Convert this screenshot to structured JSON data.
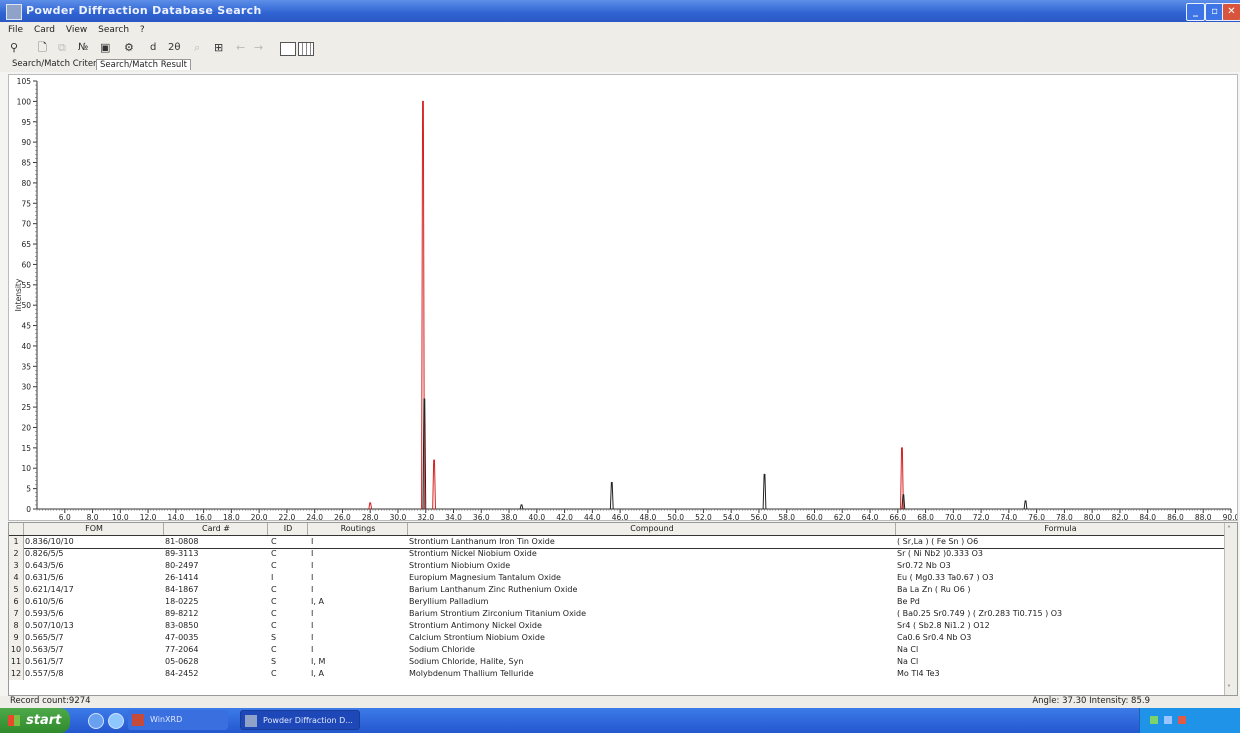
{
  "window": {
    "title": "Powder Diffraction Database Search"
  },
  "menu": [
    "File",
    "Card",
    "View",
    "Search",
    "?"
  ],
  "toolbar": {
    "no_label": "№",
    "d_label": "d",
    "two_theta_label": "2θ"
  },
  "tabs": [
    {
      "label": "Search/Match Criteria",
      "active": false
    },
    {
      "label": "Search/Match Result",
      "active": true
    }
  ],
  "chart_data": {
    "type": "line",
    "ylabel": "Intensity",
    "xlim": [
      4.0,
      90.0
    ],
    "ylim": [
      0,
      105
    ],
    "y_ticks": [
      "105",
      "100",
      "95",
      "90",
      "85",
      "80",
      "75",
      "70",
      "65",
      "60",
      "55",
      "50",
      "45",
      "40",
      "35",
      "30",
      "25",
      "20",
      "15",
      "10",
      "5",
      "0"
    ],
    "x_ticks": [
      "6.0",
      "8.0",
      "10.0",
      "12.0",
      "14.0",
      "16.0",
      "18.0",
      "20.0",
      "22.0",
      "24.0",
      "26.0",
      "28.0",
      "30.0",
      "32.0",
      "34.0",
      "36.0",
      "38.0",
      "40.0",
      "42.0",
      "44.0",
      "46.0",
      "48.0",
      "50.0",
      "52.0",
      "54.0",
      "56.0",
      "58.0",
      "60.0",
      "62.0",
      "64.0",
      "66.0",
      "68.0",
      "70.0",
      "72.0",
      "74.0",
      "76.0",
      "78.0",
      "80.0",
      "82.0",
      "84.0",
      "86.0",
      "88.0",
      "90.0"
    ],
    "series": [
      {
        "color": "#d62020",
        "peaks": [
          {
            "x": 28.0,
            "y": 1.5
          },
          {
            "x": 31.8,
            "y": 100
          },
          {
            "x": 32.6,
            "y": 12
          },
          {
            "x": 66.3,
            "y": 15
          }
        ]
      },
      {
        "color": "#222222",
        "peaks": [
          {
            "x": 31.9,
            "y": 27
          },
          {
            "x": 45.4,
            "y": 6.5
          },
          {
            "x": 56.4,
            "y": 8.5
          },
          {
            "x": 66.4,
            "y": 3.5
          },
          {
            "x": 75.2,
            "y": 2
          },
          {
            "x": 38.9,
            "y": 1
          }
        ]
      }
    ]
  },
  "table": {
    "columns": [
      "FOM",
      "Card #",
      "ID",
      "Routings",
      "Compound",
      "Formula"
    ],
    "rows": [
      {
        "n": "1",
        "fom": "0.836/10/10",
        "card": "81-0808",
        "id": "C",
        "rout": "I",
        "compound": "Strontium Lanthanum Iron Tin Oxide",
        "formula": "( Sr,La ) ( Fe Sn ) O6"
      },
      {
        "n": "2",
        "fom": "0.826/5/5",
        "card": "89-3113",
        "id": "C",
        "rout": "I",
        "compound": "Strontium Nickel Niobium Oxide",
        "formula": "Sr ( Ni Nb2 )0.333 O3"
      },
      {
        "n": "3",
        "fom": "0.643/5/6",
        "card": "80-2497",
        "id": "C",
        "rout": "I",
        "compound": "Strontium Niobium Oxide",
        "formula": "Sr0.72 Nb O3"
      },
      {
        "n": "4",
        "fom": "0.631/5/6",
        "card": "26-1414",
        "id": "I",
        "rout": "I",
        "compound": "Europium Magnesium Tantalum Oxide",
        "formula": "Eu ( Mg0.33 Ta0.67 ) O3"
      },
      {
        "n": "5",
        "fom": "0.621/14/17",
        "card": "84-1867",
        "id": "C",
        "rout": "I",
        "compound": "Barium Lanthanum Zinc Ruthenium Oxide",
        "formula": "Ba La Zn ( Ru O6 )"
      },
      {
        "n": "6",
        "fom": "0.610/5/6",
        "card": "18-0225",
        "id": "C",
        "rout": "I, A",
        "compound": "Beryllium Palladium",
        "formula": "Be Pd"
      },
      {
        "n": "7",
        "fom": "0.593/5/6",
        "card": "89-8212",
        "id": "C",
        "rout": "I",
        "compound": "Barium Strontium Zirconium Titanium Oxide",
        "formula": "( Ba0.25 Sr0.749 ) ( Zr0.283 Ti0.715 ) O3"
      },
      {
        "n": "8",
        "fom": "0.507/10/13",
        "card": "83-0850",
        "id": "C",
        "rout": "I",
        "compound": "Strontium Antimony Nickel Oxide",
        "formula": "Sr4 ( Sb2.8 Ni1.2 ) O12"
      },
      {
        "n": "9",
        "fom": "0.565/5/7",
        "card": "47-0035",
        "id": "S",
        "rout": "I",
        "compound": "Calcium Strontium Niobium Oxide",
        "formula": "Ca0.6 Sr0.4 Nb O3"
      },
      {
        "n": "10",
        "fom": "0.563/5/7",
        "card": "77-2064",
        "id": "C",
        "rout": "I",
        "compound": "Sodium Chloride",
        "formula": "Na Cl"
      },
      {
        "n": "11",
        "fom": "0.561/5/7",
        "card": "05-0628",
        "id": "S",
        "rout": "I, M",
        "compound": "Sodium Chloride, Halite, Syn",
        "formula": "Na Cl"
      },
      {
        "n": "12",
        "fom": "0.557/5/8",
        "card": "84-2452",
        "id": "C",
        "rout": "I, A",
        "compound": "Molybdenum Thallium Telluride",
        "formula": "Mo Tl4 Te3"
      }
    ]
  },
  "status": {
    "record_count": "Record count:9274",
    "readout": "Angle: 37.30  Intensity: 85.9"
  },
  "taskbar": {
    "start_label": "start",
    "tasks": [
      {
        "label": "WinXRD"
      },
      {
        "label": "Powder Diffraction D..."
      }
    ]
  }
}
